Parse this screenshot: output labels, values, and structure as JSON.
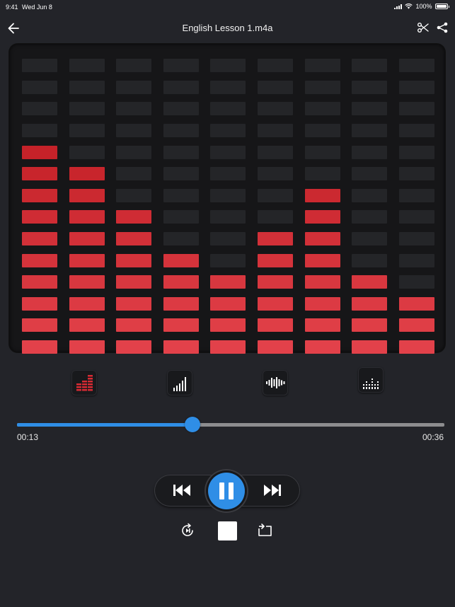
{
  "status_bar": {
    "time": "9:41",
    "date": "Wed Jun 8",
    "battery": "100%"
  },
  "header": {
    "title": "English Lesson 1.m4a"
  },
  "icons": {
    "back": "arrow-left-icon",
    "cut": "scissors-icon",
    "share": "share-icon",
    "modes": [
      "bar-eq-mode-icon",
      "ascending-bars-icon",
      "waveform-icon",
      "dotted-bars-icon"
    ],
    "prev": "skip-previous-icon",
    "pause": "pause-icon",
    "next": "skip-next-icon",
    "replay": "replay-icon",
    "stop": "stop-icon",
    "repeat": "repeat-icon"
  },
  "equalizer": {
    "rows": 14,
    "levels": [
      10,
      9,
      7,
      5,
      4,
      6,
      8,
      4,
      3
    ],
    "colors": {
      "active_top": "#b8141a",
      "active_bottom": "#e2414a",
      "inactive": "#242528",
      "active_mode": "#d82a33"
    }
  },
  "player": {
    "current_time": "00:13",
    "duration": "00:36",
    "progress": 0.41,
    "accent": "#2f8ee6"
  }
}
